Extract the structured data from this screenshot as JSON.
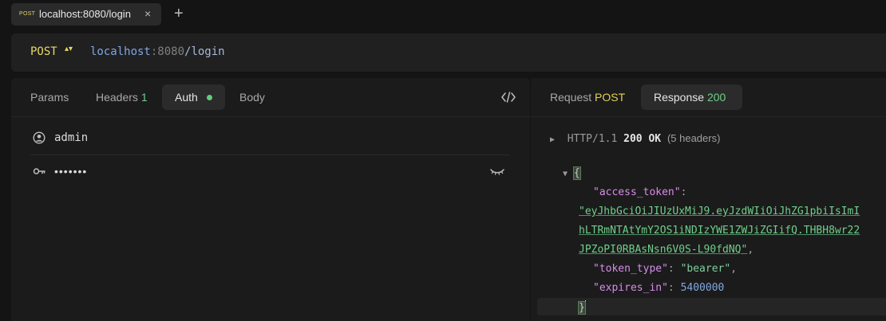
{
  "tab": {
    "method": "POST",
    "title": "localhost:8080/login",
    "close_glyph": "×",
    "new_glyph": "+"
  },
  "request": {
    "method": "POST",
    "method_arrows": "▴▾",
    "url_host": "localhost",
    "url_port": ":8080",
    "url_path": "/login"
  },
  "left_tabs": {
    "params": "Params",
    "headers": "Headers",
    "headers_count": "1",
    "auth": "Auth",
    "body": "Body"
  },
  "auth": {
    "username": "admin",
    "password_masked": "•••••••"
  },
  "right_tabs": {
    "request_label": "Request",
    "request_method": "POST",
    "response_label": "Response",
    "response_status": "200"
  },
  "response": {
    "protocol": "HTTP/1.1",
    "status": "200 OK",
    "headers_note": "(5 headers)",
    "json": {
      "open_brace": "{",
      "close_brace": "}",
      "access_token_key": "\"access_token\"",
      "access_token_line1": "\"eyJhbGciOiJIUzUxMiJ9.eyJzdWIiOiJhZG1pbiIsImI",
      "access_token_line2": "hLTRmNTAtYmY2OS1iNDIzYWE1ZWJiZGIifQ.THBH8wr22",
      "access_token_line3": "JPZoPI0RBAsNsn6V0S-L90fdNQ\"",
      "token_type_key": "\"token_type\"",
      "token_type_value": "\"bearer\"",
      "expires_in_key": "\"expires_in\"",
      "expires_in_value": "5400000"
    }
  },
  "icons": {
    "user": "user-circle-icon",
    "key": "key-icon",
    "eye": "eye-closed-icon",
    "code": "code-icon",
    "caret_right": "caret-right-icon",
    "caret_down": "caret-down-icon"
  },
  "colors": {
    "accent_yellow": "#e8d86a",
    "success_green": "#6fd08a",
    "json_key": "#d78ce8",
    "json_number": "#82a7df"
  }
}
